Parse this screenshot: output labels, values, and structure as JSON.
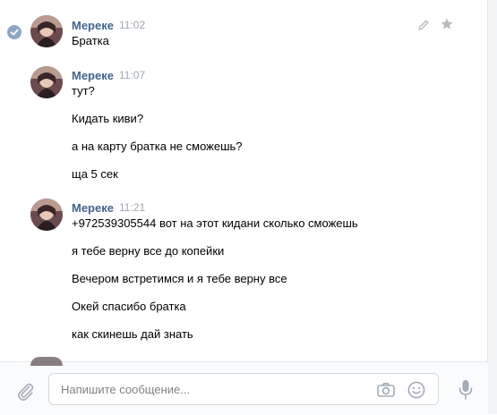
{
  "messages": [
    {
      "author": "Мереке",
      "time": "11:02",
      "lines": [
        "Братка"
      ],
      "read": true
    },
    {
      "author": "Мереке",
      "time": "11:07",
      "lines": [
        "тут?",
        "Кидать киви?",
        "а на карту братка не сможешь?",
        "ща 5 сек"
      ]
    },
    {
      "author": "Мереке",
      "time": "11:21",
      "lines": [
        "+972539305544 вот на этот кидани сколько сможешь",
        "я тебе верну все до копейки",
        "Вечером встретимся и я тебе верну все",
        "Окей спасибо братка",
        "как скинешь дай знать"
      ]
    }
  ],
  "composer": {
    "placeholder": "Напишите сообщение..."
  },
  "icons": {
    "read_check": "check-circle-icon",
    "edit": "pencil-icon",
    "favorite": "star-icon",
    "attach": "paperclip-icon",
    "camera": "camera-icon",
    "emoji": "smile-icon",
    "voice": "microphone-icon"
  },
  "colors": {
    "author_name": "#42648b",
    "time": "#a0a8b1",
    "icon_gray": "#828a99",
    "check_badge": "#8ea6c4"
  }
}
